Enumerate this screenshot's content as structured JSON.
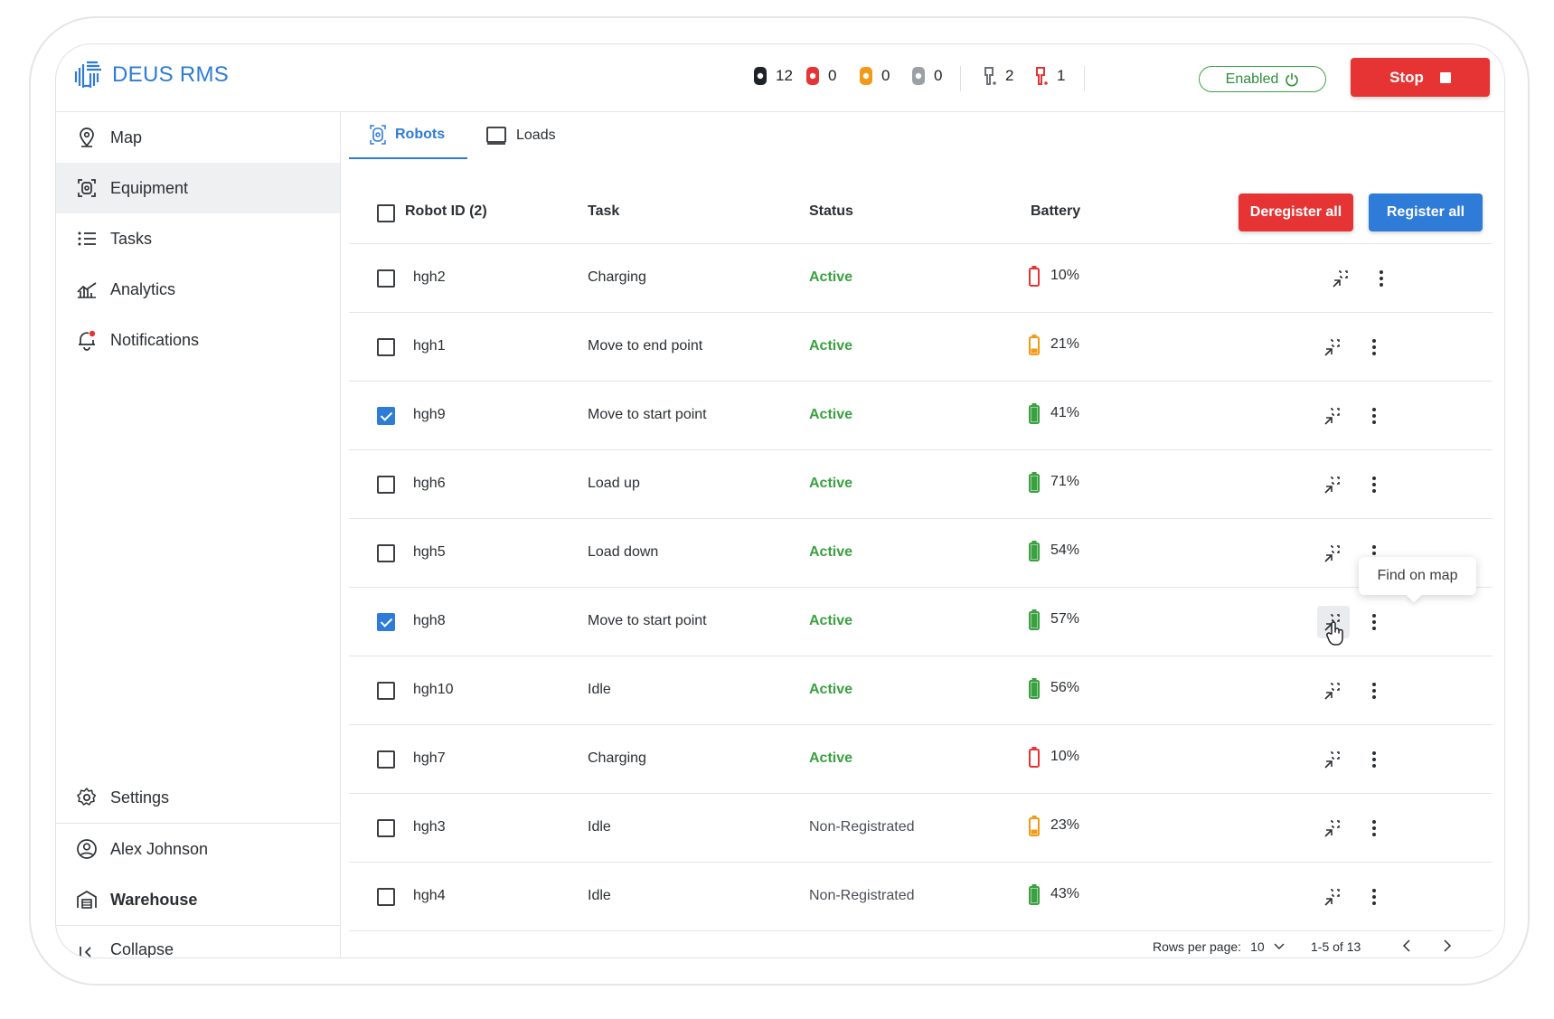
{
  "app": {
    "name": "DEUS RMS",
    "accent": "#2e7bd8"
  },
  "header": {
    "stats": [
      {
        "icon": "robot-black-icon",
        "value": "12"
      },
      {
        "icon": "robot-red-icon",
        "value": "0"
      },
      {
        "icon": "robot-orange-icon",
        "value": "0"
      },
      {
        "icon": "robot-gray-icon",
        "value": "0"
      },
      {
        "icon": "charger-gray-icon",
        "value": "2"
      },
      {
        "icon": "charger-red-icon",
        "value": "1"
      }
    ],
    "enabled_label": "Enabled",
    "stop_label": "Stop"
  },
  "sidebar": {
    "items": [
      {
        "label": "Map",
        "icon": "map-pin-icon"
      },
      {
        "label": "Equipment",
        "icon": "equipment-icon"
      },
      {
        "label": "Tasks",
        "icon": "list-icon"
      },
      {
        "label": "Analytics",
        "icon": "analytics-icon"
      },
      {
        "label": "Notifications",
        "icon": "bell-icon"
      }
    ],
    "settings_label": "Settings",
    "user_name": "Alex Johnson",
    "warehouse_label": "Warehouse",
    "collapse_label": "Collapse"
  },
  "tabs": {
    "robots": "Robots",
    "loads": "Loads"
  },
  "table": {
    "columns": {
      "robot_id": "Robot ID (2)",
      "task": "Task",
      "status": "Status",
      "battery": "Battery"
    },
    "deregister_label": "Deregister all",
    "register_label": "Register all",
    "rows": [
      {
        "id": "hgh2",
        "task": "Charging",
        "status": "Active",
        "battery": "10%",
        "level": 0.1,
        "checked": false
      },
      {
        "id": "hgh1",
        "task": "Move to end point",
        "status": "Active",
        "battery": "21%",
        "level": 0.21,
        "checked": false
      },
      {
        "id": "hgh9",
        "task": "Move to start point",
        "status": "Active",
        "battery": "41%",
        "level": 0.41,
        "checked": true
      },
      {
        "id": "hgh6",
        "task": "Load up",
        "status": "Active",
        "battery": "71%",
        "level": 0.71,
        "checked": false
      },
      {
        "id": "hgh5",
        "task": "Load down",
        "status": "Active",
        "battery": "54%",
        "level": 0.54,
        "checked": false
      },
      {
        "id": "hgh8",
        "task": "Move to start point",
        "status": "Active",
        "battery": "57%",
        "level": 0.57,
        "checked": true
      },
      {
        "id": "hgh10",
        "task": "Idle",
        "status": "Active",
        "battery": "56%",
        "level": 0.56,
        "checked": false
      },
      {
        "id": "hgh7",
        "task": "Charging",
        "status": "Active",
        "battery": "10%",
        "level": 0.1,
        "checked": false
      },
      {
        "id": "hgh3",
        "task": "Idle",
        "status": "Non-Registrated",
        "battery": "23%",
        "level": 0.23,
        "checked": false
      },
      {
        "id": "hgh4",
        "task": "Idle",
        "status": "Non-Registrated",
        "battery": "43%",
        "level": 0.43,
        "checked": false
      }
    ],
    "tooltip": "Find on map"
  },
  "pagination": {
    "rows_per_page_label": "Rows per page:",
    "rows_per_page_value": "10",
    "range": "1-5 of 13"
  },
  "colors": {
    "active": "#3aa040",
    "danger": "#e63434",
    "warning": "#f29a18",
    "ok": "#3aa040"
  }
}
